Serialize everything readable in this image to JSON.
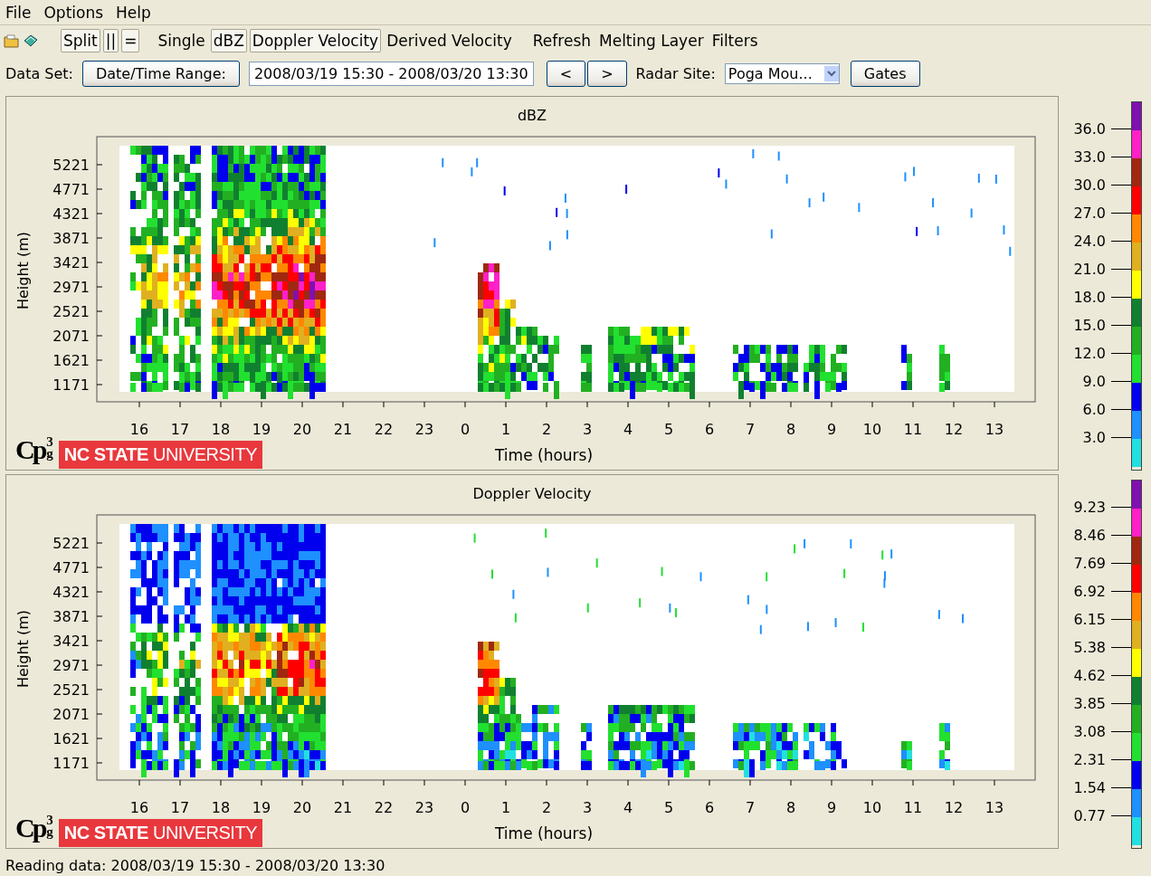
{
  "menu": [
    {
      "label": "File"
    },
    {
      "label": "Options"
    },
    {
      "label": "Help"
    }
  ],
  "toolbar": {
    "items": [
      {
        "label": "Split",
        "selected": true
      },
      {
        "label": "||",
        "selected": true
      },
      {
        "label": "=",
        "selected": true
      },
      {
        "label": "Single",
        "selected": false
      },
      {
        "label": "dBZ",
        "selected": true
      },
      {
        "label": "Doppler Velocity",
        "selected": true
      },
      {
        "label": "Derived Velocity",
        "selected": false
      },
      {
        "label": "Refresh",
        "selected": false
      },
      {
        "label": "Melting Layer",
        "selected": false
      },
      {
        "label": "Filters",
        "selected": false
      }
    ]
  },
  "dataset": {
    "label": "Data Set:",
    "range_button": "Date/Time Range:",
    "range_value": "2008/03/19 15:30 - 2008/03/20 13:30",
    "prev": "<",
    "next": ">",
    "site_label": "Radar Site:",
    "site_value": "Poga Mou...",
    "gates": "Gates"
  },
  "panels": [
    {
      "kind": "reflectivity",
      "title": "dBZ",
      "ylabel": "Height (m)",
      "xlabel": "Time (hours)",
      "yticks": [
        "5221",
        "4771",
        "4321",
        "3871",
        "3421",
        "2971",
        "2521",
        "2071",
        "1621",
        "1171"
      ],
      "xticks": [
        "16",
        "17",
        "18",
        "19",
        "20",
        "21",
        "22",
        "23",
        "0",
        "1",
        "2",
        "3",
        "4",
        "5",
        "6",
        "7",
        "8",
        "9",
        "10",
        "11",
        "12",
        "13"
      ],
      "colorbar": {
        "labels": [
          "36.0",
          "33.0",
          "30.0",
          "27.0",
          "24.0",
          "21.0",
          "18.0",
          "15.0",
          "12.0",
          "9.0",
          "6.0",
          "3.0"
        ]
      },
      "logo": {
        "main": "Cp",
        "upper": "3",
        "lower": "g",
        "banner": "**NC STATE** UNIVERSITY"
      }
    },
    {
      "kind": "velocity",
      "title": "Doppler Velocity",
      "ylabel": "Height (m)",
      "xlabel": "Time (hours)",
      "yticks": [
        "5221",
        "4771",
        "4321",
        "3871",
        "3421",
        "2971",
        "2521",
        "2071",
        "1621",
        "1171"
      ],
      "xticks": [
        "16",
        "17",
        "18",
        "19",
        "20",
        "21",
        "22",
        "23",
        "0",
        "1",
        "2",
        "3",
        "4",
        "5",
        "6",
        "7",
        "8",
        "9",
        "10",
        "11",
        "12",
        "13"
      ],
      "colorbar": {
        "labels": [
          "9.23",
          "8.46",
          "7.69",
          "6.92",
          "6.15",
          "5.38",
          "4.62",
          "3.85",
          "3.08",
          "2.31",
          "1.54",
          "0.77"
        ]
      },
      "logo": {
        "main": "Cp",
        "upper": "3",
        "lower": "g",
        "banner": "**NC STATE** UNIVERSITY"
      }
    }
  ],
  "color_bands": [
    {
      "color": "#8010b0"
    },
    {
      "color": "#ff20c8"
    },
    {
      "color": "#a02810"
    },
    {
      "color": "#ff0000"
    },
    {
      "color": "#ff8800"
    },
    {
      "color": "#e0b020"
    },
    {
      "color": "#ffff00"
    },
    {
      "color": "#108030"
    },
    {
      "color": "#22b022"
    },
    {
      "color": "#22e030"
    },
    {
      "color": "#0000ee"
    },
    {
      "color": "#1e90ff"
    },
    {
      "color": "#22e0e0"
    }
  ],
  "status": "Reading data: 2008/03/19 15:30 - 2008/03/20 13:30"
}
